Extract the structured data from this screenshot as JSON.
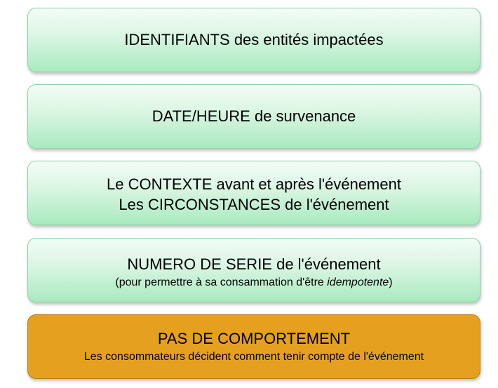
{
  "boxes": [
    {
      "line1": "IDENTIFIANTS des entités impactées"
    },
    {
      "line1": "DATE/HEURE de survenance"
    },
    {
      "line1": "Le CONTEXTE avant et après l'événement",
      "line2": "Les CIRCONSTANCES de l'événement"
    },
    {
      "line1": "NUMERO DE SERIE de l'événement",
      "sub_prefix": "(pour permettre à sa consammation d'être ",
      "sub_italic": "idempotente",
      "sub_suffix": ")"
    },
    {
      "line1": "PAS DE COMPORTEMENT",
      "sub": "Les consommateurs décident comment tenir compte de l'événement"
    }
  ],
  "colors": {
    "green_top": "#f3fcf6",
    "green_bottom": "#a9eabf",
    "green_border": "#8fd3a6",
    "orange": "#e6a020"
  }
}
